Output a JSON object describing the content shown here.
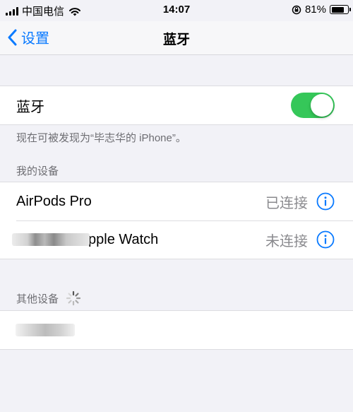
{
  "status_bar": {
    "carrier": "中国电信",
    "time": "14:07",
    "battery": "81%",
    "battery_level": 0.81
  },
  "nav": {
    "back_label": "设置",
    "title": "蓝牙"
  },
  "bluetooth": {
    "label": "蓝牙",
    "enabled": true,
    "discoverable_note": "现在可被发现为“毕志华的 iPhone”。",
    "accent_color": "#35c759"
  },
  "my_devices": {
    "header": "我的设备",
    "items": [
      {
        "name": "AirPods Pro",
        "status": "已连接"
      },
      {
        "name": "pple Watch",
        "status": "未连接"
      }
    ]
  },
  "other_devices": {
    "header": "其他设备"
  },
  "colors": {
    "link": "#0a7aff",
    "background": "#f2f2f7",
    "secondary_text": "#8a8a8e"
  }
}
